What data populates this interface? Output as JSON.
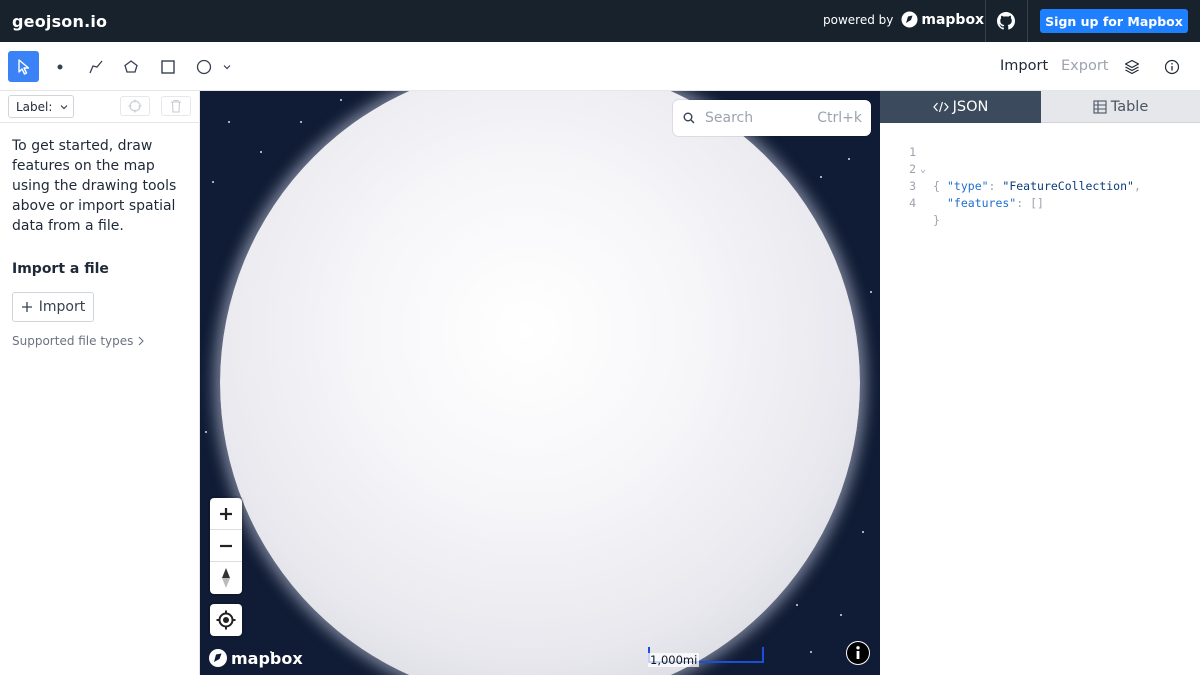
{
  "app": {
    "title": "geojson.io"
  },
  "header": {
    "powered_by": "powered by",
    "mapbox_brand": "mapbox",
    "signup_label": "Sign up for Mapbox",
    "github_icon": "github-icon"
  },
  "toolbar": {
    "tools": [
      {
        "name": "select",
        "icon": "cursor-icon",
        "active": true
      },
      {
        "name": "point",
        "icon": "point-icon"
      },
      {
        "name": "line",
        "icon": "line-icon"
      },
      {
        "name": "polygon",
        "icon": "polygon-icon"
      },
      {
        "name": "rectangle",
        "icon": "rectangle-icon"
      },
      {
        "name": "circle",
        "icon": "circle-icon"
      }
    ],
    "import_label": "Import",
    "export_label": "Export",
    "layers_icon": "layers-icon",
    "info_icon": "info-icon"
  },
  "left_panel": {
    "label_select": "Label:",
    "intro_text": "To get started, draw features on the map using the drawing tools above or import spatial data from a file.",
    "import_title": "Import a file",
    "import_button": "Import",
    "supported_link": "Supported file types"
  },
  "map": {
    "search_placeholder": "Search",
    "search_shortcut": "Ctrl+k",
    "watermark": "mapbox",
    "scale_label": "1,000mi"
  },
  "right_panel": {
    "tabs": [
      {
        "label": "JSON",
        "active": true
      },
      {
        "label": "Table",
        "active": false
      }
    ],
    "code_lines": [
      {
        "n": "1",
        "text": "{"
      },
      {
        "n": "2",
        "key": "\"type\"",
        "colon": ": ",
        "value": "\"FeatureCollection\"",
        "trail": ","
      },
      {
        "n": "3",
        "key": "\"features\"",
        "colon": ": ",
        "value": "[]",
        "trail": ""
      },
      {
        "n": "4",
        "text": "}"
      }
    ]
  },
  "colors": {
    "topbar": "#17222c",
    "accent": "#1e80ff",
    "active_tool": "#3b82f6",
    "map_space": "#101c35",
    "json_tab": "#3b4a5c"
  }
}
